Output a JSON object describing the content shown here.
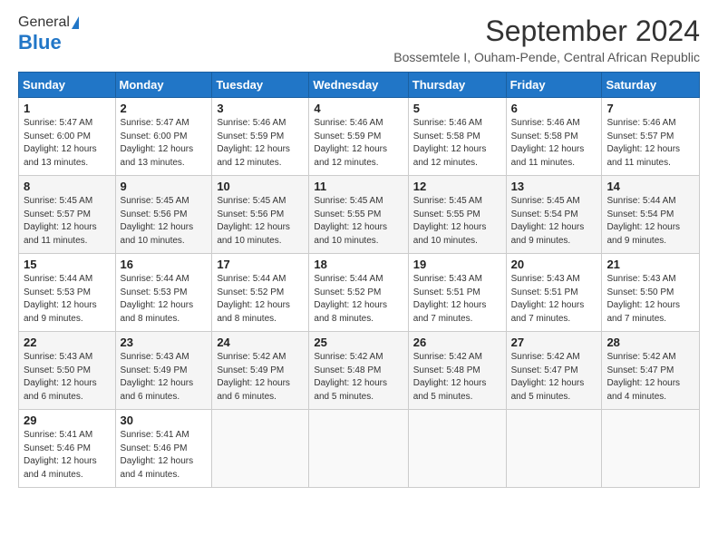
{
  "header": {
    "logo_general": "General",
    "logo_blue": "Blue",
    "month_title": "September 2024",
    "subtitle": "Bossemtele I, Ouham-Pende, Central African Republic"
  },
  "days_of_week": [
    "Sunday",
    "Monday",
    "Tuesday",
    "Wednesday",
    "Thursday",
    "Friday",
    "Saturday"
  ],
  "weeks": [
    [
      {
        "day": "1",
        "sunrise": "5:47 AM",
        "sunset": "6:00 PM",
        "daylight": "12 hours and 13 minutes."
      },
      {
        "day": "2",
        "sunrise": "5:47 AM",
        "sunset": "6:00 PM",
        "daylight": "12 hours and 13 minutes."
      },
      {
        "day": "3",
        "sunrise": "5:46 AM",
        "sunset": "5:59 PM",
        "daylight": "12 hours and 12 minutes."
      },
      {
        "day": "4",
        "sunrise": "5:46 AM",
        "sunset": "5:59 PM",
        "daylight": "12 hours and 12 minutes."
      },
      {
        "day": "5",
        "sunrise": "5:46 AM",
        "sunset": "5:58 PM",
        "daylight": "12 hours and 12 minutes."
      },
      {
        "day": "6",
        "sunrise": "5:46 AM",
        "sunset": "5:58 PM",
        "daylight": "12 hours and 11 minutes."
      },
      {
        "day": "7",
        "sunrise": "5:46 AM",
        "sunset": "5:57 PM",
        "daylight": "12 hours and 11 minutes."
      }
    ],
    [
      {
        "day": "8",
        "sunrise": "5:45 AM",
        "sunset": "5:57 PM",
        "daylight": "12 hours and 11 minutes."
      },
      {
        "day": "9",
        "sunrise": "5:45 AM",
        "sunset": "5:56 PM",
        "daylight": "12 hours and 10 minutes."
      },
      {
        "day": "10",
        "sunrise": "5:45 AM",
        "sunset": "5:56 PM",
        "daylight": "12 hours and 10 minutes."
      },
      {
        "day": "11",
        "sunrise": "5:45 AM",
        "sunset": "5:55 PM",
        "daylight": "12 hours and 10 minutes."
      },
      {
        "day": "12",
        "sunrise": "5:45 AM",
        "sunset": "5:55 PM",
        "daylight": "12 hours and 10 minutes."
      },
      {
        "day": "13",
        "sunrise": "5:45 AM",
        "sunset": "5:54 PM",
        "daylight": "12 hours and 9 minutes."
      },
      {
        "day": "14",
        "sunrise": "5:44 AM",
        "sunset": "5:54 PM",
        "daylight": "12 hours and 9 minutes."
      }
    ],
    [
      {
        "day": "15",
        "sunrise": "5:44 AM",
        "sunset": "5:53 PM",
        "daylight": "12 hours and 9 minutes."
      },
      {
        "day": "16",
        "sunrise": "5:44 AM",
        "sunset": "5:53 PM",
        "daylight": "12 hours and 8 minutes."
      },
      {
        "day": "17",
        "sunrise": "5:44 AM",
        "sunset": "5:52 PM",
        "daylight": "12 hours and 8 minutes."
      },
      {
        "day": "18",
        "sunrise": "5:44 AM",
        "sunset": "5:52 PM",
        "daylight": "12 hours and 8 minutes."
      },
      {
        "day": "19",
        "sunrise": "5:43 AM",
        "sunset": "5:51 PM",
        "daylight": "12 hours and 7 minutes."
      },
      {
        "day": "20",
        "sunrise": "5:43 AM",
        "sunset": "5:51 PM",
        "daylight": "12 hours and 7 minutes."
      },
      {
        "day": "21",
        "sunrise": "5:43 AM",
        "sunset": "5:50 PM",
        "daylight": "12 hours and 7 minutes."
      }
    ],
    [
      {
        "day": "22",
        "sunrise": "5:43 AM",
        "sunset": "5:50 PM",
        "daylight": "12 hours and 6 minutes."
      },
      {
        "day": "23",
        "sunrise": "5:43 AM",
        "sunset": "5:49 PM",
        "daylight": "12 hours and 6 minutes."
      },
      {
        "day": "24",
        "sunrise": "5:42 AM",
        "sunset": "5:49 PM",
        "daylight": "12 hours and 6 minutes."
      },
      {
        "day": "25",
        "sunrise": "5:42 AM",
        "sunset": "5:48 PM",
        "daylight": "12 hours and 5 minutes."
      },
      {
        "day": "26",
        "sunrise": "5:42 AM",
        "sunset": "5:48 PM",
        "daylight": "12 hours and 5 minutes."
      },
      {
        "day": "27",
        "sunrise": "5:42 AM",
        "sunset": "5:47 PM",
        "daylight": "12 hours and 5 minutes."
      },
      {
        "day": "28",
        "sunrise": "5:42 AM",
        "sunset": "5:47 PM",
        "daylight": "12 hours and 4 minutes."
      }
    ],
    [
      {
        "day": "29",
        "sunrise": "5:41 AM",
        "sunset": "5:46 PM",
        "daylight": "12 hours and 4 minutes."
      },
      {
        "day": "30",
        "sunrise": "5:41 AM",
        "sunset": "5:46 PM",
        "daylight": "12 hours and 4 minutes."
      },
      null,
      null,
      null,
      null,
      null
    ]
  ],
  "labels": {
    "sunrise": "Sunrise:",
    "sunset": "Sunset:",
    "daylight": "Daylight:"
  }
}
